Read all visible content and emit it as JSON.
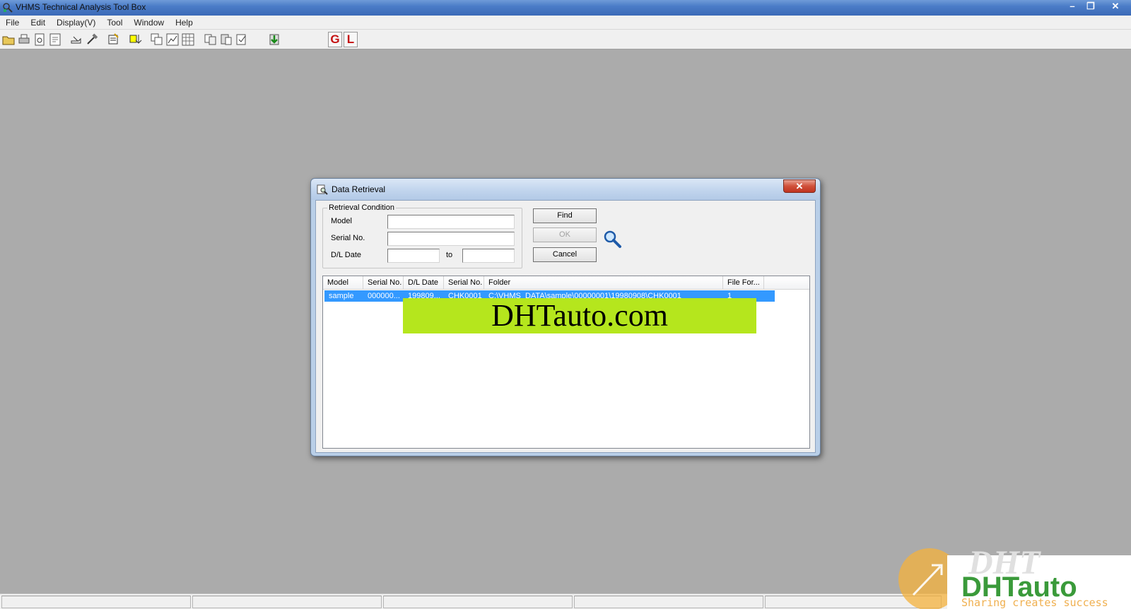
{
  "window": {
    "title": "VHMS Technical Analysis Tool Box",
    "minimize": "–",
    "restore": "❐",
    "close": "✕"
  },
  "menu": [
    "File",
    "Edit",
    "Display(V)",
    "Tool",
    "Window",
    "Help"
  ],
  "toolbar": {
    "g_label": "G",
    "l_label": "L"
  },
  "dialog": {
    "title": "Data Retrieval",
    "close": "✕",
    "group_title": "Retrieval Condition",
    "labels": {
      "model": "Model",
      "serial": "Serial No.",
      "dl_date": "D/L Date",
      "to": "to"
    },
    "values": {
      "model": "",
      "serial": "",
      "date_from": "",
      "date_to": ""
    },
    "buttons": {
      "find": "Find",
      "ok": "OK",
      "cancel": "Cancel"
    },
    "list": {
      "columns": [
        "Model",
        "Serial No.",
        "D/L Date",
        "Serial No.",
        "Folder",
        "File For..."
      ],
      "rows": [
        [
          "sample",
          "000000...",
          "199809...",
          "CHK0001",
          "C:\\VHMS_DATA\\sample\\00000001\\19980908\\CHK0001",
          "1"
        ]
      ]
    }
  },
  "banner": "DHTauto.com",
  "watermark": {
    "big": "DHT",
    "brand": "DHTauto",
    "slogan": "Sharing creates success"
  },
  "colors": {
    "selection": "#3399ff",
    "banner": "#b5e61d",
    "gl_red": "#c41010"
  }
}
